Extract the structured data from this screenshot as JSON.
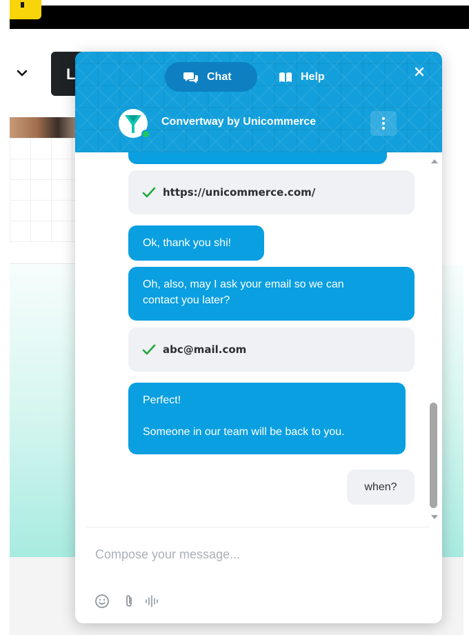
{
  "background": {
    "button_letter": "L"
  },
  "widget": {
    "tabs": [
      {
        "label": "Chat",
        "icon": "chat-bubbles-icon",
        "active": true
      },
      {
        "label": "Help",
        "icon": "book-icon",
        "active": false
      }
    ],
    "brand": {
      "name": "Convertway by Unicommerce",
      "logo": "funnel-logo-icon",
      "status": "online"
    },
    "colors": {
      "primary": "#129fdb",
      "bubble": "#0a9fe0",
      "active_tab": "#0e7fc0",
      "reply_bg": "#eff1f4",
      "check": "#1fa83a",
      "online": "#22c55e"
    }
  },
  "messages": [
    {
      "from": "bot",
      "type": "reply",
      "text": "https://unicommerce.com/"
    },
    {
      "from": "bot",
      "type": "text",
      "lines": [
        "Ok, thank you shi!"
      ]
    },
    {
      "from": "bot",
      "type": "text",
      "lines": [
        "Oh, also, may I ask your email so we can",
        "contact you later?"
      ]
    },
    {
      "from": "bot",
      "type": "reply",
      "text": "abc@mail.com"
    },
    {
      "from": "bot",
      "type": "text",
      "lines": [
        "Perfect!",
        "",
        "Someone in our team will be back to you."
      ]
    },
    {
      "from": "user",
      "type": "text",
      "lines": [
        "when?"
      ]
    }
  ],
  "composer": {
    "placeholder": "Compose your message...",
    "value": "",
    "tools": [
      "emoji-icon",
      "attachment-icon",
      "voice-icon"
    ]
  }
}
